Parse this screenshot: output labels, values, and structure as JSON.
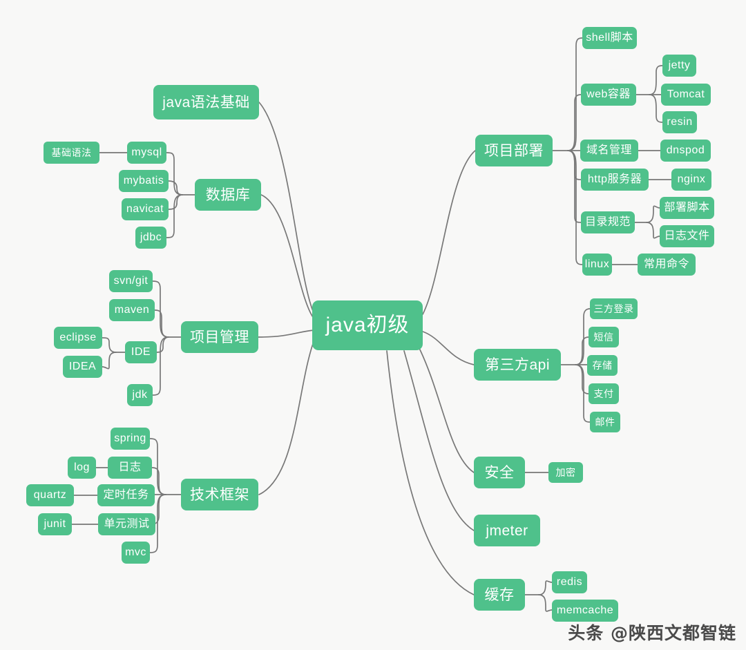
{
  "meta": {
    "background_color": "#f8f8f7",
    "node_color": "#4fc18b",
    "node_text_color": "#ffffff",
    "edge_color": "#777777",
    "watermark": "头条 @陕西文都智链"
  },
  "root": {
    "label": "java初级"
  },
  "nodes": {
    "java_syntax": "java语法基础",
    "basic_syntax": "基础语法",
    "database": "数据库",
    "mysql": "mysql",
    "mybatis": "mybatis",
    "navicat": "navicat",
    "jdbc": "jdbc",
    "project_mgmt": "项目管理",
    "svn_git": "svn/git",
    "maven": "maven",
    "ide": "IDE",
    "eclipse": "eclipse",
    "idea": "IDEA",
    "jdk": "jdk",
    "tech_framework": "技术框架",
    "spring": "spring",
    "log_cn": "日志",
    "log_en": "log",
    "scheduled_task": "定时任务",
    "quartz": "quartz",
    "unit_test": "单元测试",
    "junit": "junit",
    "mvc": "mvc",
    "project_deploy": "项目部署",
    "shell_script": "shell脚本",
    "web_container": "web容器",
    "jetty": "jetty",
    "tomcat": "Tomcat",
    "resin": "resin",
    "domain_mgmt": "域名管理",
    "dnspod": "dnspod",
    "http_server": "http服务器",
    "nginx": "nginx",
    "dir_spec": "目录规范",
    "deploy_script": "部署脚本",
    "log_file": "日志文件",
    "linux": "linux",
    "common_cmd": "常用命令",
    "third_party_api": "第三方api",
    "third_login": "三方登录",
    "sms": "短信",
    "storage": "存储",
    "payment": "支付",
    "email": "邮件",
    "security": "安全",
    "encryption": "加密",
    "jmeter": "jmeter",
    "cache": "缓存",
    "redis": "redis",
    "memcache": "memcache"
  }
}
